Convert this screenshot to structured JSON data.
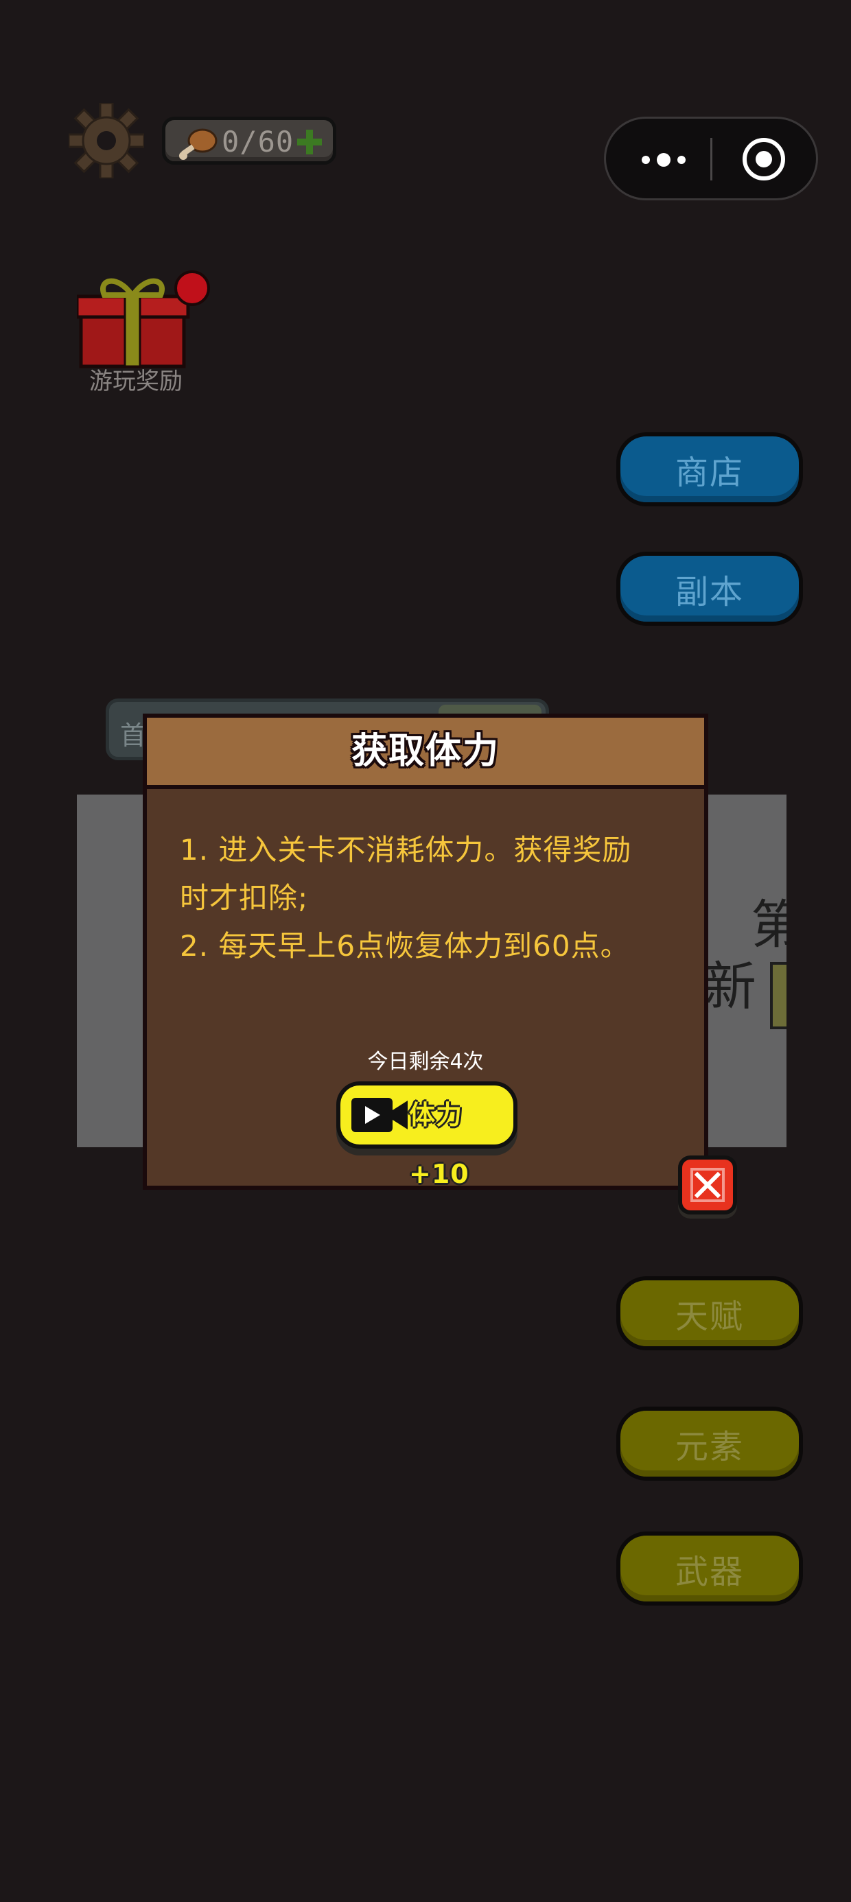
{
  "hud": {
    "stamina_value": "0/60",
    "gear_icon": "gear-icon",
    "stamina_icon": "drumstick-icon",
    "add_icon": "plus-icon"
  },
  "capsule": {
    "more_icon": "more-dots-icon",
    "close_icon": "target-circle-icon"
  },
  "gift": {
    "label": "游玩奖励",
    "icon": "gift-icon"
  },
  "menu": {
    "shop": "商店",
    "dungeon": "副本",
    "talent": "天赋",
    "element": "元素",
    "weapon": "武器"
  },
  "background_card": {
    "tab_label": "首",
    "side_text_1": "第",
    "side_text_2": "新"
  },
  "modal": {
    "title": "获取体力",
    "rules": [
      "1. 进入关卡不消耗体力。获得奖励",
      "时才扣除;",
      "2. 每天早上6点恢复体力到60点。"
    ],
    "remaining_text": "今日剩余4次",
    "video_button_label": "体力+10",
    "video_icon": "video-camera-icon",
    "close_icon": "close-x-icon"
  },
  "colors": {
    "background": "#1c1718",
    "modal_body": "#543827",
    "modal_header": "#9b6b3e",
    "rule_text": "#f6c63c",
    "video_button": "#f7ee1e",
    "close_button": "#e8321e",
    "menu_blue": "#0b5b8e",
    "menu_olive": "#6b6800"
  }
}
